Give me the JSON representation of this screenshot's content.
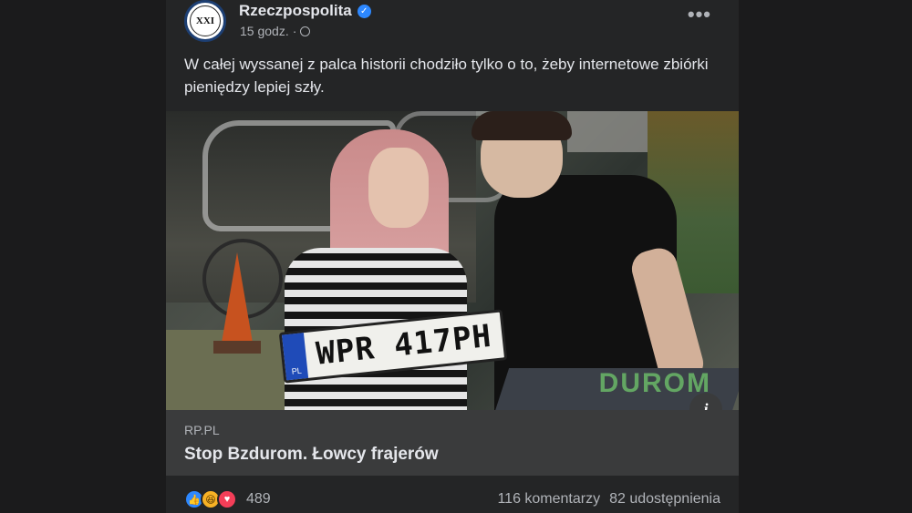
{
  "post": {
    "page_name": "Rzeczpospolita",
    "avatar_text": "XXI",
    "time": "15 godz.",
    "separator": "·",
    "text": "W całej wyssanej z palca historii chodziło tylko o to, żeby internetowe zbiórki pieniędzy lepiej szły.",
    "more_label": "•••"
  },
  "photo": {
    "plate_text": "WPR 417PH",
    "plate_country": "PL",
    "sign_text": "DUROM",
    "info_label": "i"
  },
  "link": {
    "domain": "RP.PL",
    "title": "Stop Bzdurom. Łowcy frajerów"
  },
  "footer": {
    "reaction_count": "489",
    "comments": "116 komentarzy",
    "shares": "82 udostępnienia"
  },
  "icons": {
    "like": "👍",
    "haha": "😆",
    "love": "♥"
  }
}
